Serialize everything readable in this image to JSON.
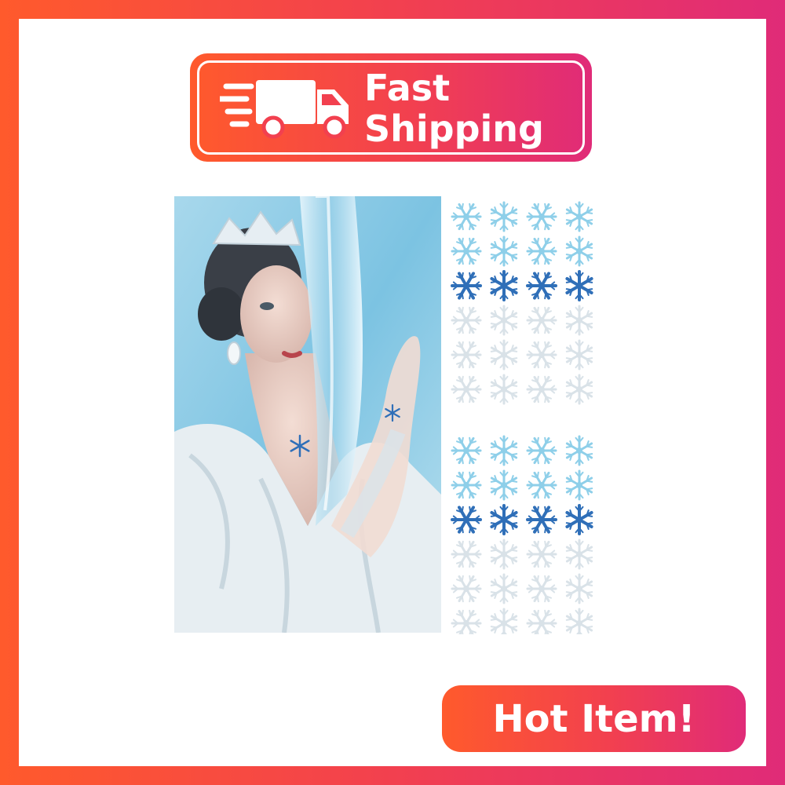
{
  "badges": {
    "shipping_line1": "Fast",
    "shipping_line2": "Shipping",
    "hot": "Hot Item!"
  },
  "icons": {
    "truck": "delivery-truck-icon",
    "snowflake": "snowflake-icon"
  },
  "colors": {
    "gradient_start": "#ff5a2c",
    "gradient_mid": "#f2404f",
    "gradient_end": "#e02b78",
    "flake_light_blue": "#8ecfe9",
    "flake_dark_blue": "#2f6fb8",
    "flake_white": "#d9e2e8"
  },
  "product": {
    "sheet_rows": [
      "light-blue",
      "light-blue",
      "dark-blue",
      "white",
      "white",
      "white",
      "light-blue",
      "light-blue",
      "dark-blue",
      "white",
      "white",
      "white"
    ],
    "flakes_per_row": 4
  }
}
